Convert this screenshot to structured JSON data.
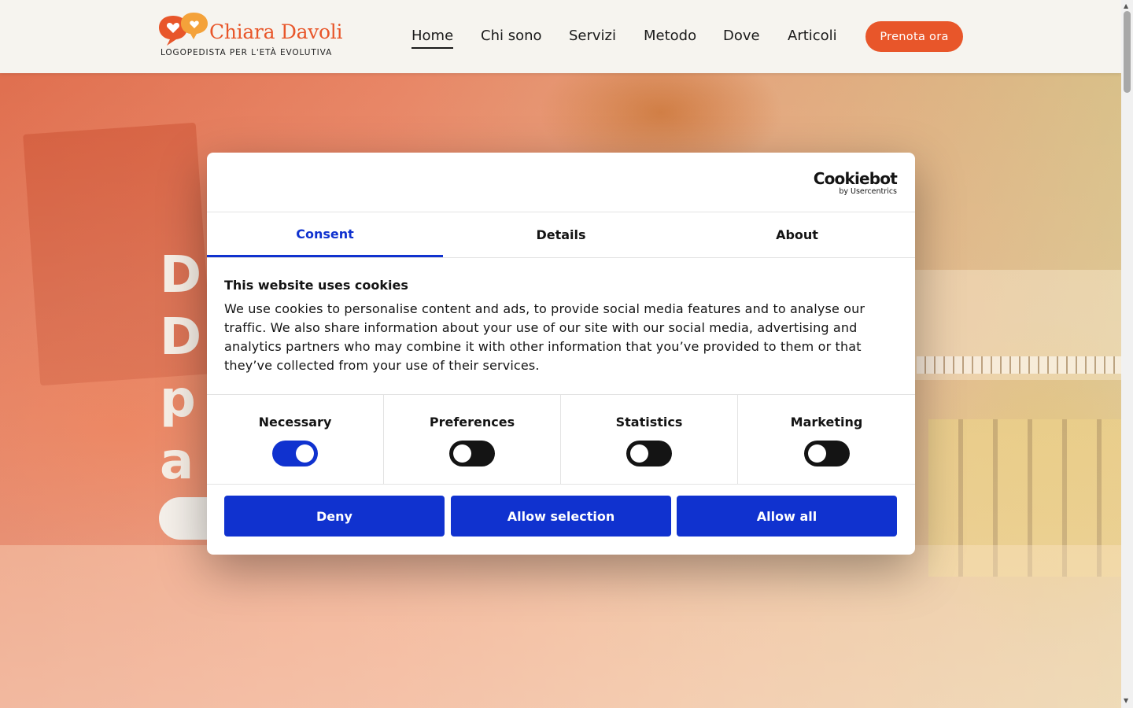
{
  "header": {
    "logo_name": "Chiara Davoli",
    "logo_tagline": "LOGOPEDISTA PER L'ETÀ EVOLUTIVA",
    "nav": [
      {
        "label": "Home",
        "active": true
      },
      {
        "label": "Chi sono",
        "active": false
      },
      {
        "label": "Servizi",
        "active": false
      },
      {
        "label": "Metodo",
        "active": false
      },
      {
        "label": "Dove",
        "active": false
      },
      {
        "label": "Articoli",
        "active": false
      }
    ],
    "cta_label": "Prenota ora",
    "accent": "#e8562a"
  },
  "hero": {
    "title_lines": [
      "D",
      "D",
      "p",
      "a"
    ]
  },
  "cookie_dialog": {
    "brand": "Cookiebot",
    "brand_sub": "by Usercentrics",
    "tabs": [
      {
        "label": "Consent",
        "active": true
      },
      {
        "label": "Details",
        "active": false
      },
      {
        "label": "About",
        "active": false
      }
    ],
    "title": "This website uses cookies",
    "text": "We use cookies to personalise content and ads, to provide social media features and to analyse our traffic. We also share information about your use of our site with our social media, advertising and analytics partners who may combine it with other information that you’ve provided to them or that they’ve collected from your use of their services.",
    "toggles": [
      {
        "label": "Necessary",
        "on": true
      },
      {
        "label": "Preferences",
        "on": false
      },
      {
        "label": "Statistics",
        "on": false
      },
      {
        "label": "Marketing",
        "on": false
      }
    ],
    "buttons": {
      "deny": "Deny",
      "allow_selection": "Allow selection",
      "allow_all": "Allow all"
    },
    "primary_color": "#1032cf"
  }
}
